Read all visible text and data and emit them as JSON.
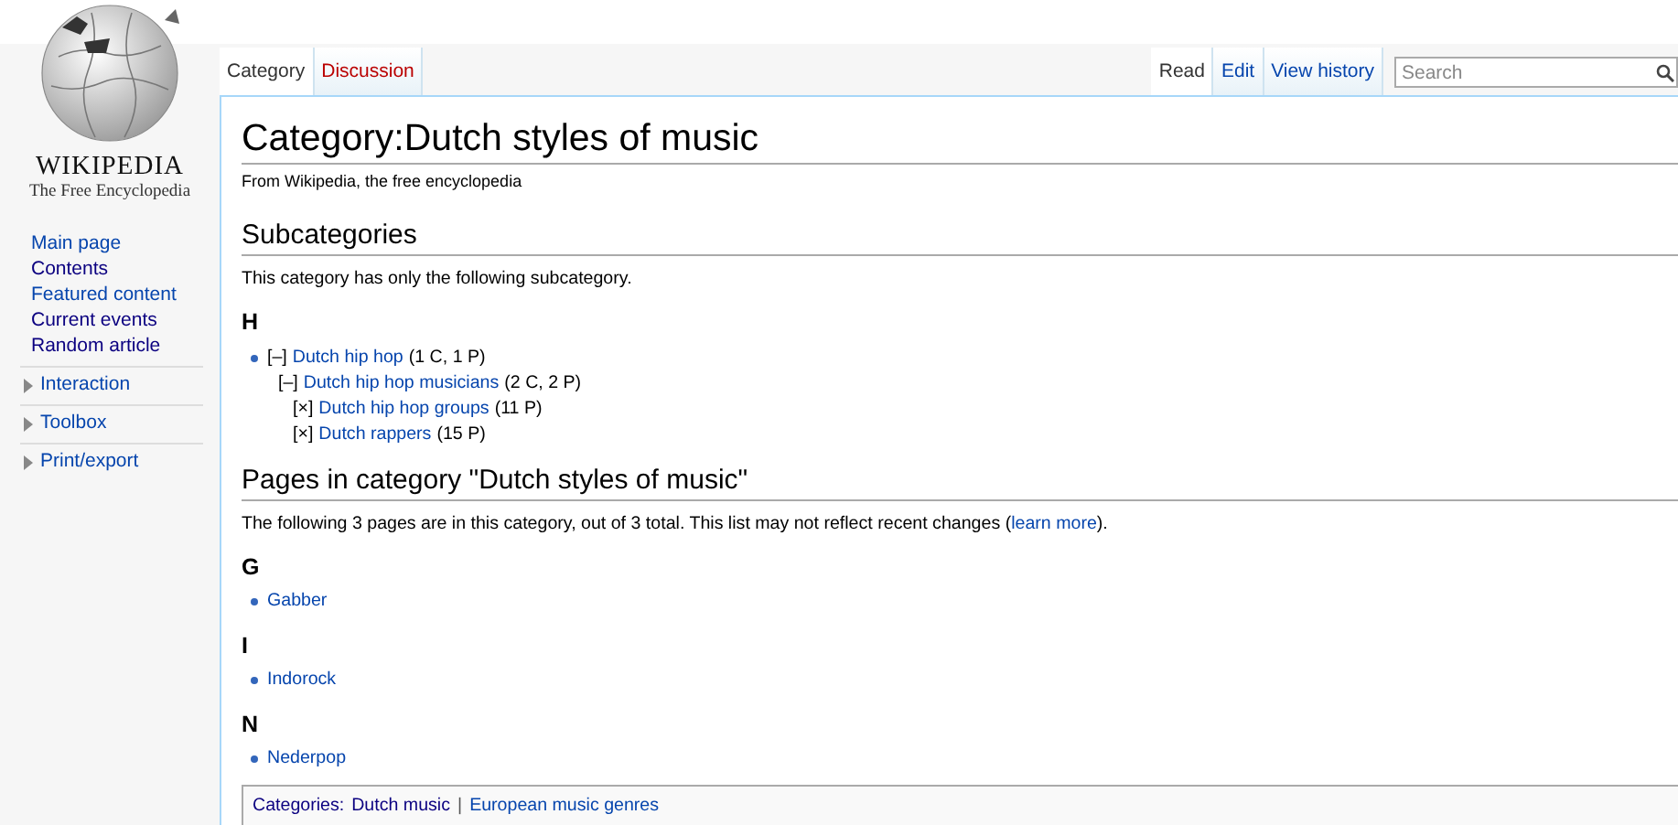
{
  "logo": {
    "wordmark": "WIKIPEDIA",
    "tagline": "The Free Encyclopedia"
  },
  "sidebar": {
    "items": [
      {
        "label": "Main page",
        "visited": false
      },
      {
        "label": "Contents",
        "visited": true
      },
      {
        "label": "Featured content",
        "visited": false
      },
      {
        "label": "Current events",
        "visited": true
      },
      {
        "label": "Random article",
        "visited": true
      }
    ],
    "portals": [
      {
        "label": "Interaction",
        "expanded": false
      },
      {
        "label": "Toolbox",
        "expanded": false
      },
      {
        "label": "Print/export",
        "expanded": false
      }
    ]
  },
  "namespace_tabs": [
    {
      "label": "Category",
      "selected": true,
      "redlink": false
    },
    {
      "label": "Discussion",
      "selected": false,
      "redlink": true
    }
  ],
  "view_tabs": [
    {
      "label": "Read",
      "selected": true
    },
    {
      "label": "Edit",
      "selected": false
    },
    {
      "label": "View history",
      "selected": false
    }
  ],
  "search": {
    "placeholder": "Search"
  },
  "article": {
    "title": "Category:Dutch styles of music",
    "tagline": "From Wikipedia, the free encyclopedia",
    "subcategories": {
      "heading": "Subcategories",
      "intro": "This category has only the following subcategory.",
      "groups": [
        {
          "letter": "H",
          "items": [
            {
              "toggle": "[–]",
              "label": "Dutch hip hop",
              "count": "(1 C, 1 P)",
              "children": [
                {
                  "toggle": "[–]",
                  "label": "Dutch hip hop musicians",
                  "count": "(2 C, 2 P)",
                  "children": [
                    {
                      "toggle": "[×]",
                      "label": "Dutch hip hop groups",
                      "count": "(11 P)"
                    },
                    {
                      "toggle": "[×]",
                      "label": "Dutch rappers",
                      "count": "(15 P)"
                    }
                  ]
                }
              ]
            }
          ]
        }
      ]
    },
    "pages": {
      "heading": "Pages in category \"Dutch styles of music\"",
      "intro": "The following 3 pages are in this category, out of 3 total. This list may not reflect recent changes (",
      "intro_link": "learn more",
      "intro_end": ").",
      "groups": [
        {
          "letter": "G",
          "items": [
            "Gabber"
          ]
        },
        {
          "letter": "I",
          "items": [
            "Indorock"
          ]
        },
        {
          "letter": "N",
          "items": [
            "Nederpop"
          ]
        }
      ]
    },
    "categories": {
      "label": "Categories:",
      "separator": "|",
      "links": [
        {
          "label": "Dutch music",
          "visited": true
        },
        {
          "label": "European music genres",
          "visited": false
        }
      ]
    }
  }
}
